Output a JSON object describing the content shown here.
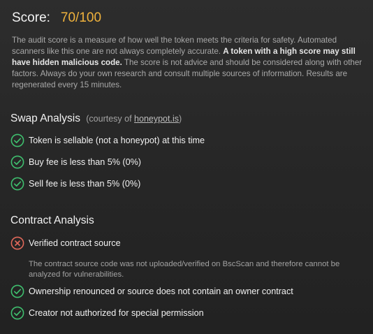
{
  "score": {
    "label": "Score:",
    "value": "70/100"
  },
  "description": {
    "part1": "The audit score is a measure of how well the token meets the criteria for safety. Automated scanners like this one are not always completely accurate. ",
    "bold": "A token with a high score may still have hidden malicious code.",
    "part2": " The score is not advice and should be considered along with other factors. Always do your own research and consult multiple sources of information. Results are regenerated every 15 minutes."
  },
  "swap_analysis": {
    "title": "Swap Analysis",
    "courtesy_prefix": "(courtesy of ",
    "courtesy_link": "honeypot.is",
    "courtesy_suffix": ")",
    "checks": [
      {
        "text": "Token is sellable (not a honeypot) at this time",
        "status": "pass"
      },
      {
        "text": "Buy fee is less than 5% (0%)",
        "status": "pass"
      },
      {
        "text": "Sell fee is less than 5% (0%)",
        "status": "pass"
      }
    ]
  },
  "contract_analysis": {
    "title": "Contract Analysis",
    "checks": [
      {
        "text": "Verified contract source",
        "status": "fail",
        "note": "The contract source code was not uploaded/verified on BscScan and therefore cannot be analyzed for vulnerabilities."
      },
      {
        "text": "Ownership renounced or source does not contain an owner contract",
        "status": "pass"
      },
      {
        "text": "Creator not authorized for special permission",
        "status": "pass"
      }
    ]
  },
  "icons": {
    "pass": "check-circle-icon",
    "fail": "x-circle-icon"
  },
  "colors": {
    "score": "#f0b23c",
    "pass": "#3fbf6e",
    "fail": "#e0685a"
  }
}
